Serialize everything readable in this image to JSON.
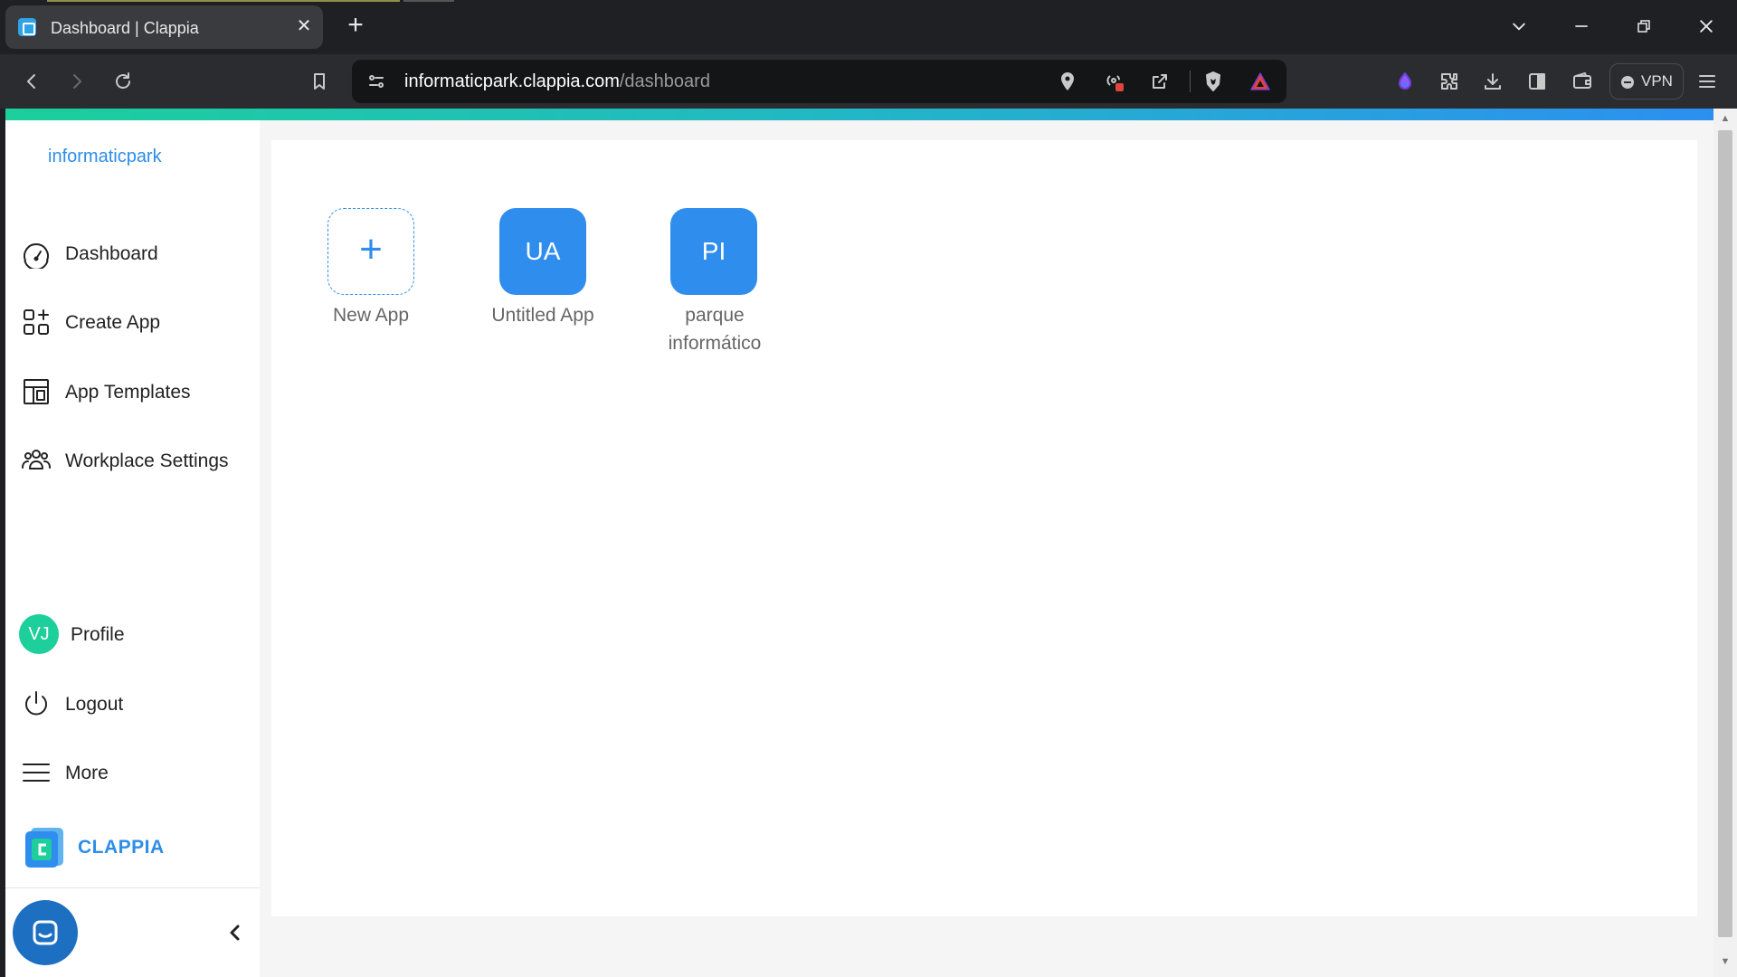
{
  "browser": {
    "tab_title": "Dashboard | Clappia",
    "tab_close": "✕",
    "new_tab": "+",
    "url_host": "informaticpark.clappia.com",
    "url_path": "/dashboard",
    "vpn_label": "VPN",
    "window_controls": {
      "dropdown": "⌄",
      "minimize": "—",
      "restore": "❐",
      "close": "✕"
    }
  },
  "sidebar": {
    "workspace_name": "informaticpark",
    "nav": [
      {
        "label": "Dashboard",
        "icon": "dashboard-gauge-icon"
      },
      {
        "label": "Create App",
        "icon": "create-app-grid-icon"
      },
      {
        "label": "App Templates",
        "icon": "app-templates-layout-icon"
      },
      {
        "label": "Workplace Settings",
        "icon": "users-group-icon"
      }
    ],
    "profile": {
      "initials": "VJ",
      "label": "Profile",
      "avatar_color": "#1ccf9b"
    },
    "logout_label": "Logout",
    "more_label": "More",
    "brand_text": "CLAPPIA"
  },
  "apps": [
    {
      "icon_text": "+",
      "label": "New App",
      "type": "new"
    },
    {
      "icon_text": "UA",
      "label": "Untitled App",
      "type": "app"
    },
    {
      "icon_text": "PI",
      "label": "parque informático",
      "type": "app"
    }
  ],
  "colors": {
    "accent_blue": "#2f8ded",
    "brand_green": "#1ccf9b",
    "chat_blue": "#1d6fc2"
  }
}
